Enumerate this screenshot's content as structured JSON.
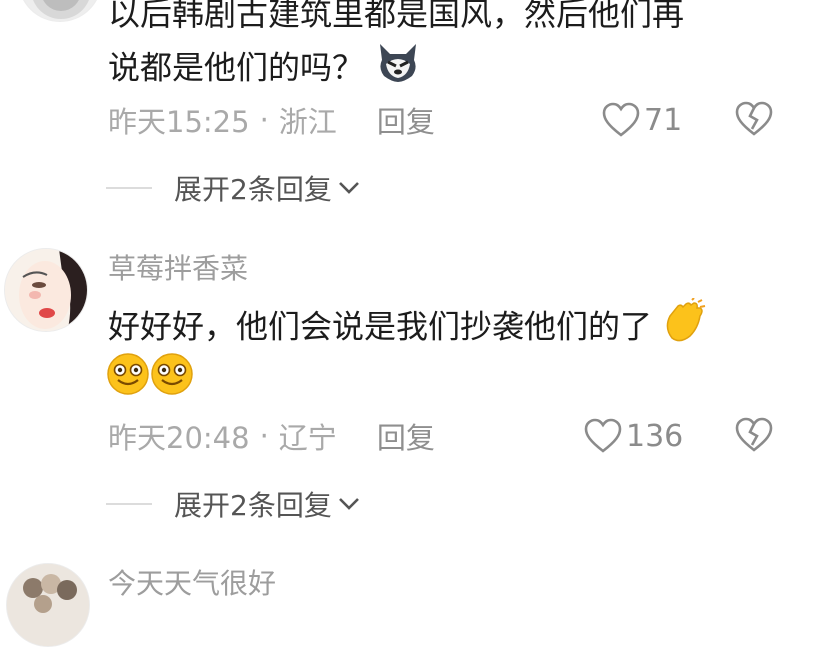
{
  "comments": [
    {
      "text_line1": "以后韩剧古建筑里都是国风，然后他们再",
      "text_line2": "说都是他们的吗？",
      "emoji": "wolf-face",
      "time": "昨天15:25",
      "location": "浙江",
      "reply_label": "回复",
      "likes": "71",
      "expand_label": "展开2条回复"
    },
    {
      "username": "草莓拌香菜",
      "text_line1": "好好好，他们会说是我们抄袭他们的了",
      "emoji_inline": "clapping-hands",
      "emoji_line2": [
        "smiling-face",
        "smiling-face"
      ],
      "time": "昨天20:48",
      "location": "辽宁",
      "reply_label": "回复",
      "likes": "136",
      "expand_label": "展开2条回复"
    },
    {
      "username": "今天天气很好"
    }
  ],
  "colors": {
    "text": "#1c1c1c",
    "meta": "#a9a9a9",
    "username": "#9d9d9d"
  }
}
